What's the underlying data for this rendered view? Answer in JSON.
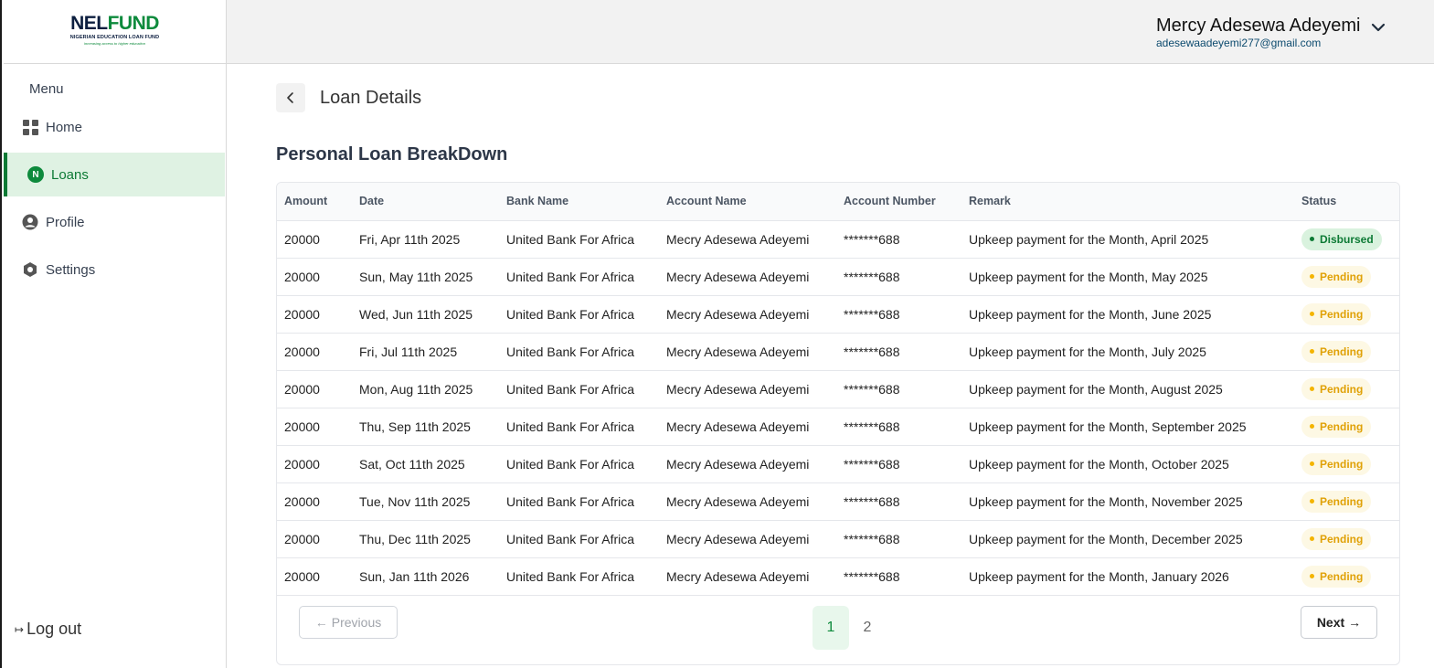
{
  "logo": {
    "part1": "NEL",
    "part2": "FUND",
    "subtitle": "NIGERIAN EDUCATION LOAN FUND",
    "tagline": "increasing access to higher education"
  },
  "user": {
    "name": "Mercy Adesewa Adeyemi",
    "email": "adesewaadeyemi277@gmail.com"
  },
  "sidebar": {
    "menu_label": "Menu",
    "items": [
      {
        "label": "Home",
        "icon": "grid-icon"
      },
      {
        "label": "Loans",
        "icon": "naira-icon",
        "active": true
      },
      {
        "label": "Profile",
        "icon": "user-icon"
      },
      {
        "label": "Settings",
        "icon": "settings-icon"
      }
    ],
    "logout_label": "Log out"
  },
  "page": {
    "title": "Loan Details",
    "section_title": "Personal Loan BreakDown"
  },
  "table": {
    "columns": [
      "Amount",
      "Date",
      "Bank Name",
      "Account Name",
      "Account Number",
      "Remark",
      "Status"
    ],
    "rows": [
      [
        "20000",
        "Fri, Apr 11th 2025",
        "United Bank For Africa",
        "Mecry Adesewa Adeyemi",
        "*******688",
        "Upkeep payment for the Month, April 2025",
        "Disbursed"
      ],
      [
        "20000",
        "Sun, May 11th 2025",
        "United Bank For Africa",
        "Mecry Adesewa Adeyemi",
        "*******688",
        "Upkeep payment for the Month, May 2025",
        "Pending"
      ],
      [
        "20000",
        "Wed, Jun 11th 2025",
        "United Bank For Africa",
        "Mecry Adesewa Adeyemi",
        "*******688",
        "Upkeep payment for the Month, June 2025",
        "Pending"
      ],
      [
        "20000",
        "Fri, Jul 11th 2025",
        "United Bank For Africa",
        "Mecry Adesewa Adeyemi",
        "*******688",
        "Upkeep payment for the Month, July 2025",
        "Pending"
      ],
      [
        "20000",
        "Mon, Aug 11th 2025",
        "United Bank For Africa",
        "Mecry Adesewa Adeyemi",
        "*******688",
        "Upkeep payment for the Month, August 2025",
        "Pending"
      ],
      [
        "20000",
        "Thu, Sep 11th 2025",
        "United Bank For Africa",
        "Mecry Adesewa Adeyemi",
        "*******688",
        "Upkeep payment for the Month, September 2025",
        "Pending"
      ],
      [
        "20000",
        "Sat, Oct 11th 2025",
        "United Bank For Africa",
        "Mecry Adesewa Adeyemi",
        "*******688",
        "Upkeep payment for the Month, October 2025",
        "Pending"
      ],
      [
        "20000",
        "Tue, Nov 11th 2025",
        "United Bank For Africa",
        "Mecry Adesewa Adeyemi",
        "*******688",
        "Upkeep payment for the Month, November 2025",
        "Pending"
      ],
      [
        "20000",
        "Thu, Dec 11th 2025",
        "United Bank For Africa",
        "Mecry Adesewa Adeyemi",
        "*******688",
        "Upkeep payment for the Month, December 2025",
        "Pending"
      ],
      [
        "20000",
        "Sun, Jan 11th 2026",
        "United Bank For Africa",
        "Mecry Adesewa Adeyemi",
        "*******688",
        "Upkeep payment for the Month, January 2026",
        "Pending"
      ]
    ]
  },
  "pagination": {
    "previous_label": "Previous",
    "next_label": "Next",
    "pages": [
      "1",
      "2"
    ],
    "current": "1"
  },
  "colors": {
    "brand_green": "#0d8a3c",
    "brand_navy": "#0c1e3f",
    "pending": "#e0a106",
    "disbursed": "#0d7a35"
  }
}
